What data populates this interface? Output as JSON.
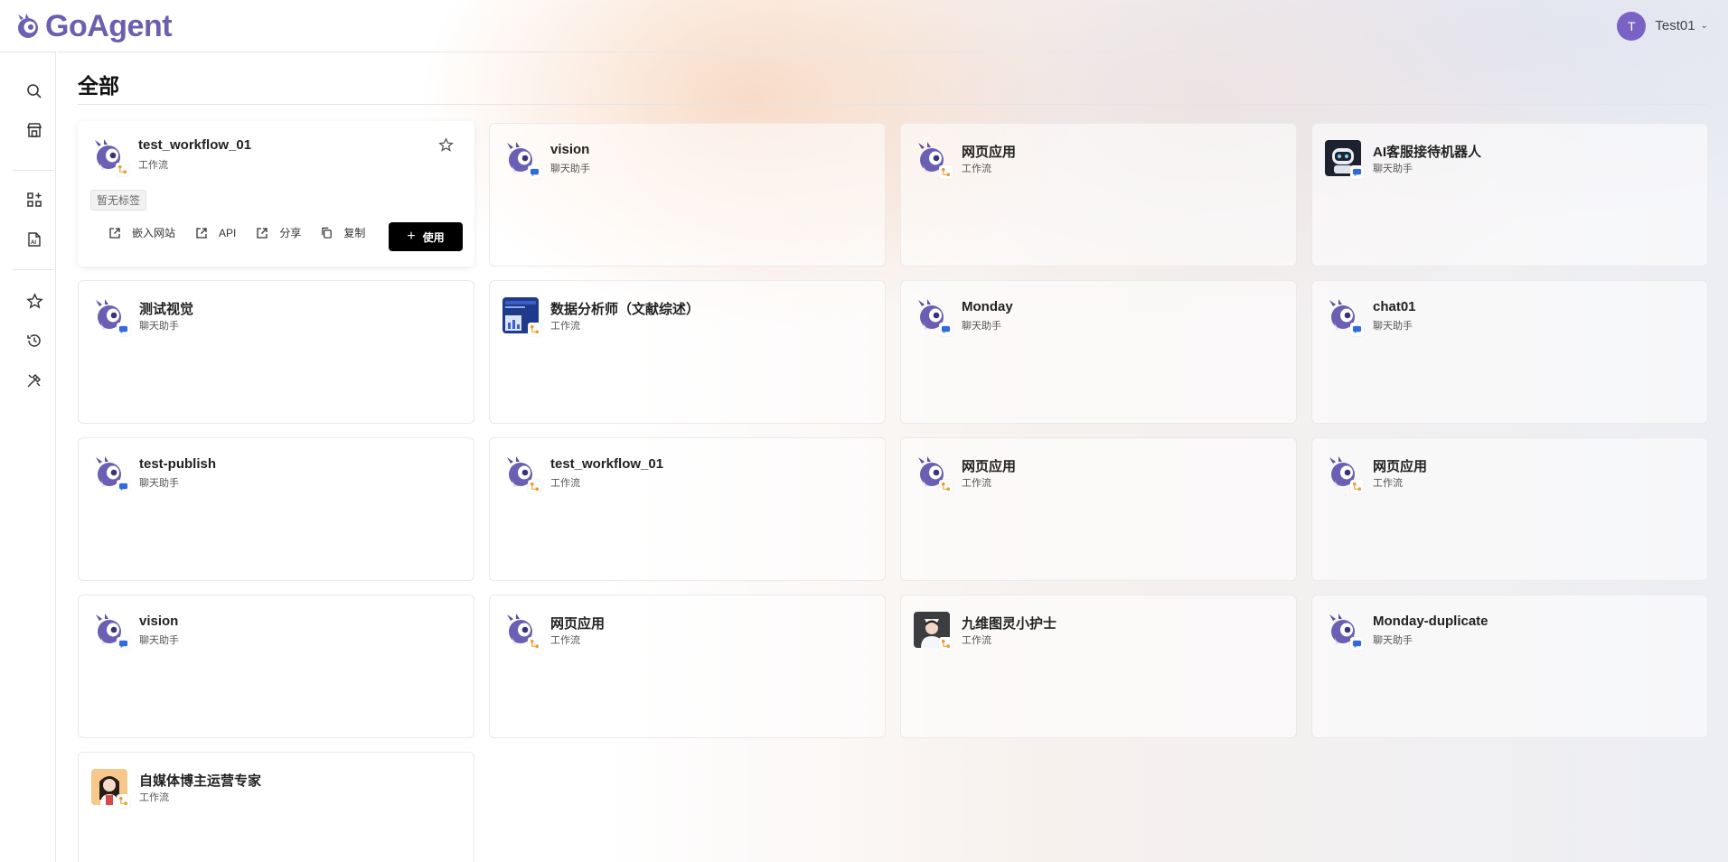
{
  "brand": {
    "name": "GoAgent"
  },
  "user": {
    "initial": "T",
    "name": "Test01"
  },
  "page": {
    "title": "全部"
  },
  "sidebar": {
    "items": [
      {
        "icon": "search-icon"
      },
      {
        "icon": "store-icon"
      },
      {
        "icon": "apps-add-icon"
      },
      {
        "icon": "ai-document-icon"
      },
      {
        "icon": "star-icon"
      },
      {
        "icon": "history-icon"
      },
      {
        "icon": "tools-icon"
      }
    ]
  },
  "first_card": {
    "tag": "暂无标签",
    "actions": {
      "embed": "嵌入网站",
      "api": "API",
      "share": "分享",
      "copy": "复制",
      "use": "使用"
    }
  },
  "cards": [
    {
      "name": "test_workflow_01",
      "type": "工作流",
      "avatar": "robot",
      "badge": "workflow"
    },
    {
      "name": "vision",
      "type": "聊天助手",
      "avatar": "robot",
      "badge": "chat"
    },
    {
      "name": "网页应用",
      "type": "工作流",
      "avatar": "robot",
      "badge": "workflow"
    },
    {
      "name": "AI客服接待机器人",
      "type": "聊天助手",
      "avatar": "service-bot",
      "badge": "chat"
    },
    {
      "name": "测试视觉",
      "type": "聊天助手",
      "avatar": "robot",
      "badge": "chat"
    },
    {
      "name": "数据分析师（文献综述）",
      "type": "工作流",
      "avatar": "analyst",
      "badge": "workflow"
    },
    {
      "name": "Monday",
      "type": "聊天助手",
      "avatar": "robot",
      "badge": "chat"
    },
    {
      "name": "chat01",
      "type": "聊天助手",
      "avatar": "robot",
      "badge": "chat"
    },
    {
      "name": "test-publish",
      "type": "聊天助手",
      "avatar": "robot",
      "badge": "chat"
    },
    {
      "name": "test_workflow_01",
      "type": "工作流",
      "avatar": "robot",
      "badge": "workflow"
    },
    {
      "name": "网页应用",
      "type": "工作流",
      "avatar": "robot",
      "badge": "workflow"
    },
    {
      "name": "网页应用",
      "type": "工作流",
      "avatar": "robot",
      "badge": "workflow"
    },
    {
      "name": "vision",
      "type": "聊天助手",
      "avatar": "robot",
      "badge": "chat"
    },
    {
      "name": "网页应用",
      "type": "工作流",
      "avatar": "robot",
      "badge": "workflow"
    },
    {
      "name": "九维图灵小护士",
      "type": "工作流",
      "avatar": "nurse",
      "badge": "workflow"
    },
    {
      "name": "Monday-duplicate",
      "type": "聊天助手",
      "avatar": "robot",
      "badge": "chat"
    },
    {
      "name": "自媒体博主运营专家",
      "type": "工作流",
      "avatar": "blogger",
      "badge": "workflow"
    }
  ]
}
